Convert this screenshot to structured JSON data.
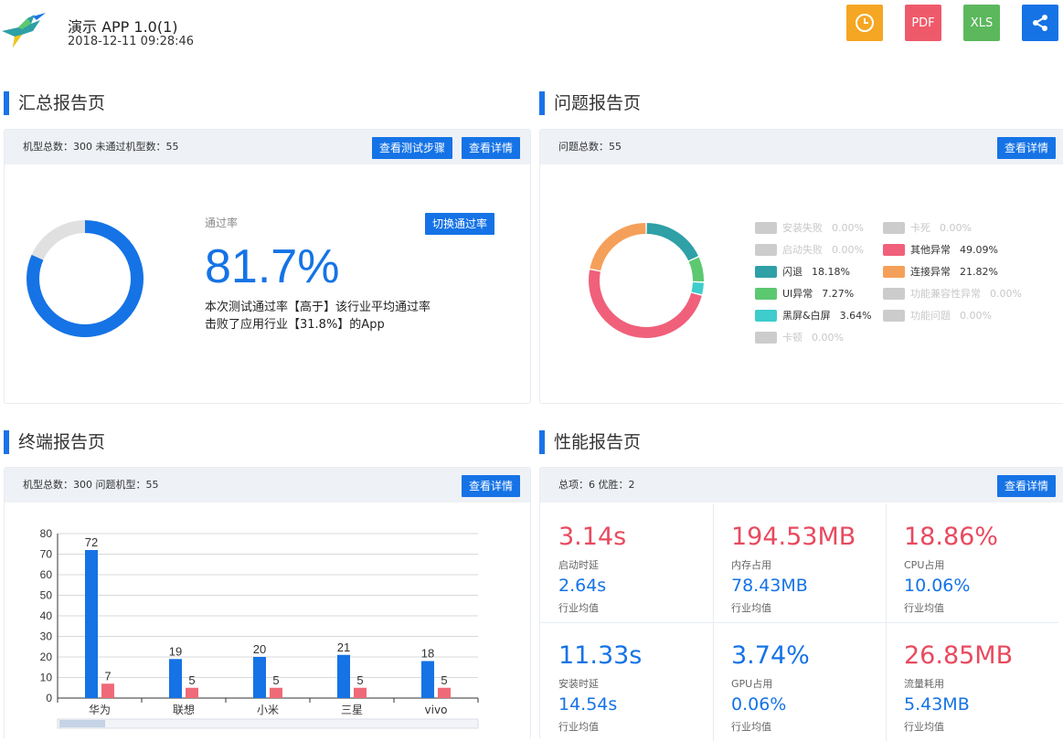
{
  "header": {
    "app_name": "演示 APP 1.0(1)",
    "timestamp": "2018-12-11 09:28:46",
    "buttons": [
      {
        "id": "history",
        "label": "",
        "icon": "clock-icon",
        "color": "#f5a623"
      },
      {
        "id": "pdf",
        "label": "PDF",
        "icon": "",
        "color": "#ef5a6a"
      },
      {
        "id": "xls",
        "label": "XLS",
        "icon": "",
        "color": "#5cb85c"
      },
      {
        "id": "share",
        "label": "",
        "icon": "share-icon",
        "color": "#1573e6"
      }
    ]
  },
  "summary": {
    "title": "汇总报告页",
    "stats": "机型总数：300 未通过机型数：55",
    "steps_btn": "查看测试步骤",
    "detail_btn": "查看详情",
    "rate_label": "通过率",
    "switch_btn": "切换通过率",
    "rate_value": "81.7%",
    "pass_rate": 0.817,
    "desc_line1": "本次测试通过率【高于】该行业平均通过率",
    "desc_line2": "击败了应用行业【31.8%】的App"
  },
  "issues": {
    "title": "问题报告页",
    "stats": "问题总数：55",
    "detail_btn": "查看详情",
    "legend": [
      {
        "label": "安装失败",
        "pct": "0.00%",
        "value": 0,
        "color": "#cccccc",
        "active": false
      },
      {
        "label": "卡死",
        "pct": "0.00%",
        "value": 0,
        "color": "#cccccc",
        "active": false
      },
      {
        "label": "启动失败",
        "pct": "0.00%",
        "value": 0,
        "color": "#cccccc",
        "active": false
      },
      {
        "label": "其他异常",
        "pct": "49.09%",
        "value": 49.09,
        "color": "#f0607a",
        "active": true
      },
      {
        "label": "闪退",
        "pct": "18.18%",
        "value": 18.18,
        "color": "#2ea0a6",
        "active": true
      },
      {
        "label": "连接异常",
        "pct": "21.82%",
        "value": 21.82,
        "color": "#f5a05a",
        "active": true
      },
      {
        "label": "UI异常",
        "pct": "7.27%",
        "value": 7.27,
        "color": "#5cc870",
        "active": true
      },
      {
        "label": "功能兼容性异常",
        "pct": "0.00%",
        "value": 0,
        "color": "#cccccc",
        "active": false
      },
      {
        "label": "黑屏&白屏",
        "pct": "3.64%",
        "value": 3.64,
        "color": "#3ecccc",
        "active": true
      },
      {
        "label": "功能问题",
        "pct": "0.00%",
        "value": 0,
        "color": "#cccccc",
        "active": false
      },
      {
        "label": "卡顿",
        "pct": "0.00%",
        "value": 0,
        "color": "#cccccc",
        "active": false
      }
    ],
    "ring_order": [
      "闪退",
      "UI异常",
      "黑屏&白屏",
      "其他异常",
      "连接异常"
    ]
  },
  "terminal": {
    "title": "终端报告页",
    "stats": "机型总数：300 问题机型：55",
    "detail_btn": "查看详情"
  },
  "chart_data": {
    "type": "bar",
    "categories": [
      "华为",
      "联想",
      "小米",
      "三星",
      "vivo"
    ],
    "series": [
      {
        "values": [
          72,
          19,
          20,
          21,
          18
        ],
        "color": "#1573e6"
      },
      {
        "values": [
          7,
          5,
          5,
          5,
          5
        ],
        "color": "#ef6a78"
      }
    ],
    "ylim": [
      0,
      80
    ],
    "yticks": [
      0,
      10,
      20,
      30,
      40,
      50,
      60,
      70,
      80
    ],
    "grid": true
  },
  "performance": {
    "title": "性能报告页",
    "stats": "总项：6 优胜：2",
    "detail_btn": "查看详情",
    "metrics": [
      {
        "value": "3.14s",
        "label": "启动时延",
        "avg": "2.64s",
        "avg_label": "行业均值",
        "color": "#e84a5f"
      },
      {
        "value": "194.53MB",
        "label": "内存占用",
        "avg": "78.43MB",
        "avg_label": "行业均值",
        "color": "#e84a5f"
      },
      {
        "value": "18.86%",
        "label": "CPU占用",
        "avg": "10.06%",
        "avg_label": "行业均值",
        "color": "#e84a5f"
      },
      {
        "value": "11.33s",
        "label": "安装时延",
        "avg": "14.54s",
        "avg_label": "行业均值",
        "color": "#1573e6"
      },
      {
        "value": "3.74%",
        "label": "GPU占用",
        "avg": "0.06%",
        "avg_label": "行业均值",
        "color": "#1573e6"
      },
      {
        "value": "26.85MB",
        "label": "流量耗用",
        "avg": "5.43MB",
        "avg_label": "行业均值",
        "color": "#e84a5f"
      }
    ]
  }
}
